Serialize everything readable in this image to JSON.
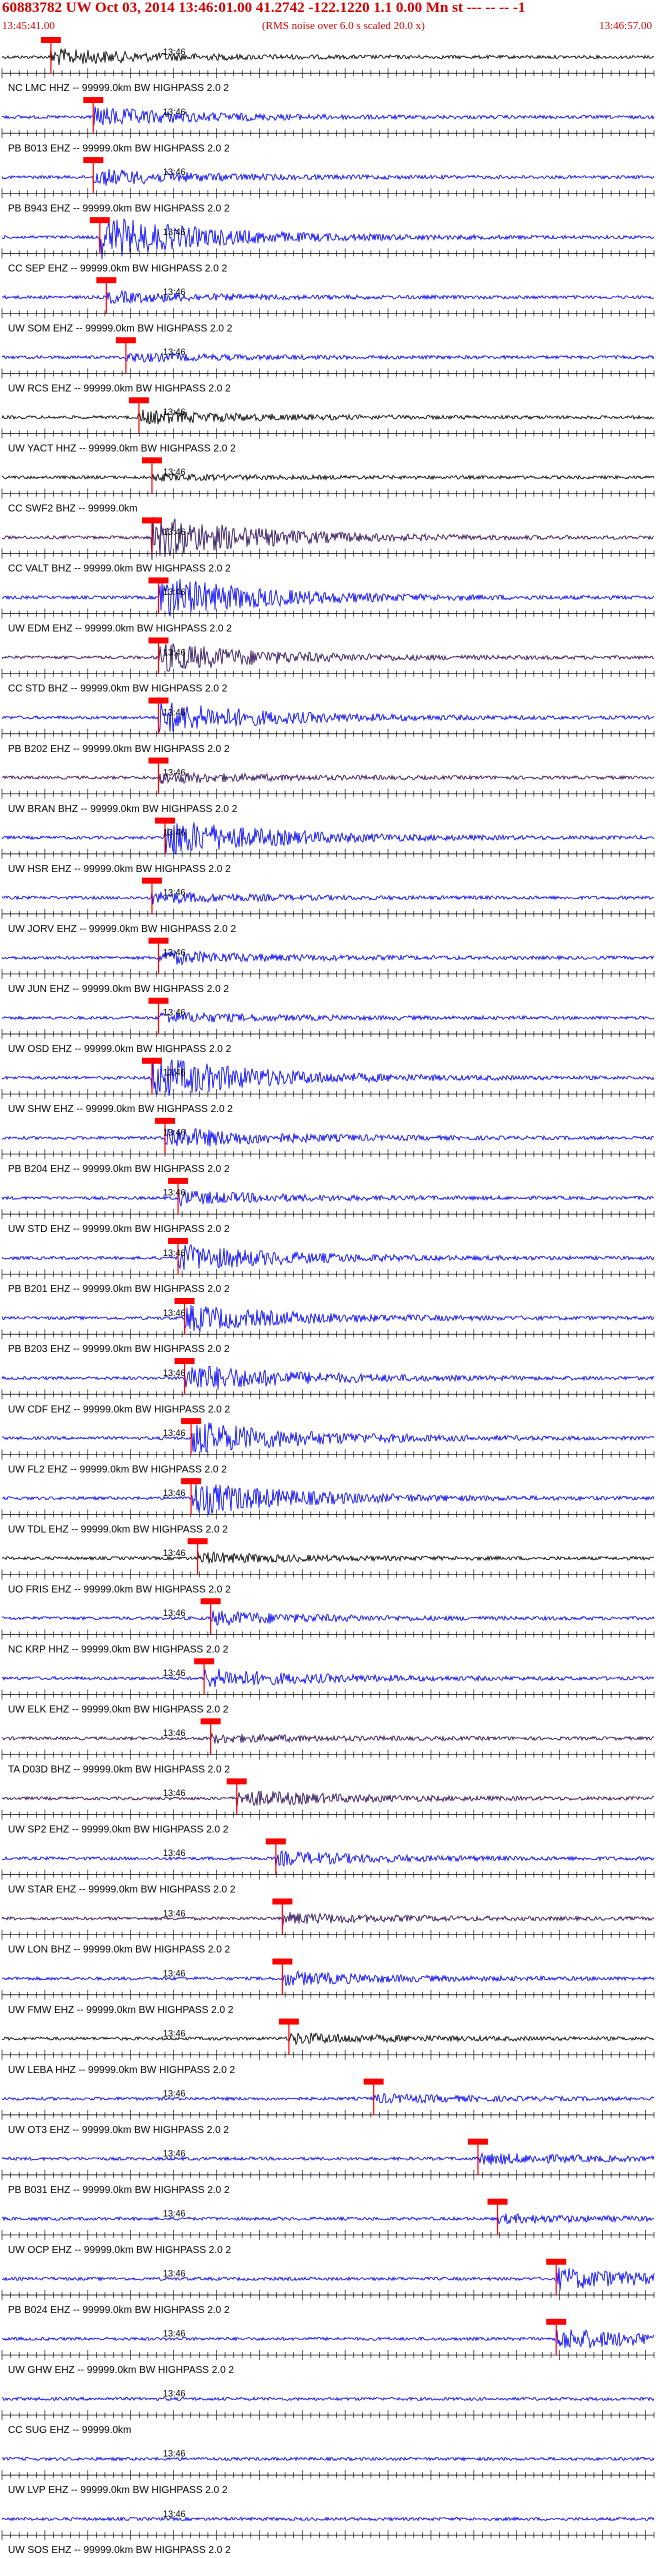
{
  "header": {
    "title": "60883782 UW Oct 03, 2014 13:46:01.00   41.2742  -122.1220  1.1 0.00 Mn st --- -- --  -1",
    "start_time": "13:45:41.00",
    "note": "(RMS noise over 6.0 s scaled 20.0 x)",
    "end_time": "13:46:57.00"
  },
  "colors": {
    "header": "#d00000",
    "blue": "#0000ff",
    "black": "#000000",
    "purple": "#2a0a5a",
    "pick": "#ff0000"
  },
  "time_label": "13:46",
  "traces": [
    {
      "label": "NC LMC HHZ -- 99999.0km BW  HIGHPASS  2.0  2",
      "color": "black",
      "pick": 0.075,
      "amp": 0.6
    },
    {
      "label": "PB B013 EHZ -- 99999.0km BW  HIGHPASS  2.0  2",
      "color": "blue",
      "pick": 0.14,
      "amp": 0.7
    },
    {
      "label": "PB B943 EHZ -- 99999.0km BW  HIGHPASS  2.0  2",
      "color": "blue",
      "pick": 0.14,
      "amp": 0.6
    },
    {
      "label": "CC SEP EHZ -- 99999.0km BW  HIGHPASS  2.0  2",
      "color": "blue",
      "pick": 0.15,
      "amp": 1.6
    },
    {
      "label": "UW SOM EHZ -- 99999.0km BW  HIGHPASS  2.0  2",
      "color": "blue",
      "pick": 0.16,
      "amp": 0.4
    },
    {
      "label": "UW RCS EHZ -- 99999.0km BW  HIGHPASS  2.0  2",
      "color": "blue",
      "pick": 0.19,
      "amp": 0.3
    },
    {
      "label": "UW YACT HHZ -- 99999.0km BW  HIGHPASS  2.0  2",
      "color": "black",
      "pick": 0.21,
      "amp": 0.5
    },
    {
      "label": "CC SWF2 BHZ -- 99999.0km",
      "color": "black",
      "pick": 0.23,
      "amp": 0.2
    },
    {
      "label": "CC VALT BHZ -- 99999.0km BW  HIGHPASS  2.0  2",
      "color": "purple",
      "pick": 0.23,
      "amp": 1.6
    },
    {
      "label": "UW EDM EHZ -- 99999.0km BW  HIGHPASS  2.0  2",
      "color": "blue",
      "pick": 0.24,
      "amp": 1.6
    },
    {
      "label": "CC STD BHZ -- 99999.0km BW  HIGHPASS  2.0  2",
      "color": "purple",
      "pick": 0.24,
      "amp": 1.1
    },
    {
      "label": "PB B202 EHZ -- 99999.0km BW  HIGHPASS  2.0  2",
      "color": "blue",
      "pick": 0.24,
      "amp": 1.2
    },
    {
      "label": "UW BRAN BHZ -- 99999.0km BW  HIGHPASS  2.0  2",
      "color": "purple",
      "pick": 0.24,
      "amp": 0.4
    },
    {
      "label": "UW HSR EHZ -- 99999.0km BW  HIGHPASS  2.0  2",
      "color": "blue",
      "pick": 0.25,
      "amp": 1.4
    },
    {
      "label": "UW JORV EHZ -- 99999.0km BW  HIGHPASS  2.0  2",
      "color": "blue",
      "pick": 0.23,
      "amp": 0.4
    },
    {
      "label": "UW JUN EHZ -- 99999.0km BW  HIGHPASS  2.0  2",
      "color": "blue",
      "pick": 0.24,
      "amp": 0.5
    },
    {
      "label": "UW OSD EHZ -- 99999.0km BW  HIGHPASS  2.0  2",
      "color": "blue",
      "pick": 0.24,
      "amp": 0.4
    },
    {
      "label": "UW SHW EHZ -- 99999.0km BW  HIGHPASS  2.0  2",
      "color": "blue",
      "pick": 0.23,
      "amp": 1.6
    },
    {
      "label": "PB B204 EHZ -- 99999.0km BW  HIGHPASS  2.0  2",
      "color": "blue",
      "pick": 0.25,
      "amp": 0.8
    },
    {
      "label": "UW STD EHZ -- 99999.0km BW  HIGHPASS  2.0  2",
      "color": "blue",
      "pick": 0.27,
      "amp": 0.5
    },
    {
      "label": "PB B201 EHZ -- 99999.0km BW  HIGHPASS  2.0  2",
      "color": "blue",
      "pick": 0.27,
      "amp": 1.0
    },
    {
      "label": "PB B203 EHZ -- 99999.0km BW  HIGHPASS  2.0  2",
      "color": "blue",
      "pick": 0.28,
      "amp": 1.0
    },
    {
      "label": "UW CDF EHZ -- 99999.0km BW  HIGHPASS  2.0  2",
      "color": "blue",
      "pick": 0.28,
      "amp": 1.1
    },
    {
      "label": "UW FL2 EHZ -- 99999.0km BW  HIGHPASS  2.0  2",
      "color": "blue",
      "pick": 0.29,
      "amp": 1.3
    },
    {
      "label": "UW TDL EHZ -- 99999.0km BW  HIGHPASS  2.0  2",
      "color": "blue",
      "pick": 0.29,
      "amp": 1.3
    },
    {
      "label": "UO FRIS EHZ -- 99999.0km BW  HIGHPASS  2.0  2",
      "color": "black",
      "pick": 0.3,
      "amp": 0.4
    },
    {
      "label": "NC KRP HHZ -- 99999.0km BW  HIGHPASS  2.0  2",
      "color": "blue",
      "pick": 0.32,
      "amp": 0.5
    },
    {
      "label": "UW ELK EHZ -- 99999.0km BW  HIGHPASS  2.0  2",
      "color": "blue",
      "pick": 0.31,
      "amp": 0.7
    },
    {
      "label": "TA D03D BHZ -- 99999.0km BW  HIGHPASS  2.0  2",
      "color": "purple",
      "pick": 0.32,
      "amp": 0.3
    },
    {
      "label": "UW SP2 EHZ -- 99999.0km BW  HIGHPASS  2.0  2",
      "color": "purple",
      "pick": 0.36,
      "amp": 0.6
    },
    {
      "label": "UW STAR EHZ -- 99999.0km BW  HIGHPASS  2.0  2",
      "color": "blue",
      "pick": 0.42,
      "amp": 0.5
    },
    {
      "label": "UW LON BHZ -- 99999.0km BW  HIGHPASS  2.0  2",
      "color": "purple",
      "pick": 0.43,
      "amp": 0.4
    },
    {
      "label": "UW FMW EHZ -- 99999.0km BW  HIGHPASS  2.0  2",
      "color": "blue",
      "pick": 0.43,
      "amp": 0.5
    },
    {
      "label": "UW LEBA HHZ -- 99999.0km BW  HIGHPASS  2.0  2",
      "color": "black",
      "pick": 0.44,
      "amp": 0.4
    },
    {
      "label": "UW OT3 EHZ -- 99999.0km BW  HIGHPASS  2.0  2",
      "color": "blue",
      "pick": 0.57,
      "amp": 0.3
    },
    {
      "label": "PB B031 EHZ -- 99999.0km BW  HIGHPASS  2.0  2",
      "color": "blue",
      "pick": 0.73,
      "amp": 0.4
    },
    {
      "label": "UW OCP EHZ -- 99999.0km BW  HIGHPASS  2.0  2",
      "color": "blue",
      "pick": 0.76,
      "amp": 0.3
    },
    {
      "label": "PB B024 EHZ -- 99999.0km BW  HIGHPASS  2.0  2",
      "color": "blue",
      "pick": 0.85,
      "amp": 0.8
    },
    {
      "label": "UW GHW EHZ -- 99999.0km BW  HIGHPASS  2.0  2",
      "color": "blue",
      "pick": 0.85,
      "amp": 0.8
    },
    {
      "label": "CC SUG EHZ -- 99999.0km",
      "color": "blue",
      "pick": null,
      "amp": 0.0
    },
    {
      "label": "UW LVP EHZ -- 99999.0km BW  HIGHPASS  2.0  2",
      "color": "blue",
      "pick": null,
      "amp": 0.2
    },
    {
      "label": "UW SOS EHZ -- 99999.0km BW  HIGHPASS  2.0  2",
      "color": "blue",
      "pick": null,
      "amp": 0.2
    }
  ]
}
